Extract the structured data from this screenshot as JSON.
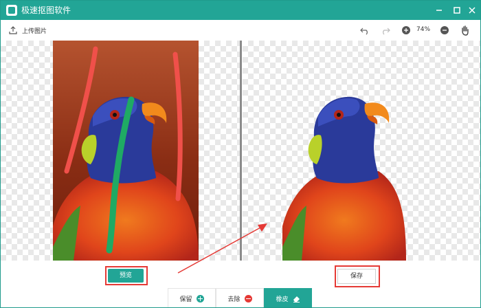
{
  "window": {
    "title": "极速抠图软件"
  },
  "toolbar": {
    "upload_label": "上传图片",
    "zoom": "74%"
  },
  "actions": {
    "preview_label": "预览",
    "save_label": "保存"
  },
  "tools": [
    {
      "label": "保留",
      "icon": "plus-circle-icon",
      "color": "#22a596"
    },
    {
      "label": "去除",
      "icon": "minus-circle-icon",
      "color": "#e53935"
    },
    {
      "label": "橡皮",
      "icon": "eraser-icon",
      "active": true
    }
  ],
  "colors": {
    "accent": "#22a596",
    "highlight": "#e53935",
    "keep_stroke": "#1faa64",
    "remove_stroke": "#f0504a"
  }
}
